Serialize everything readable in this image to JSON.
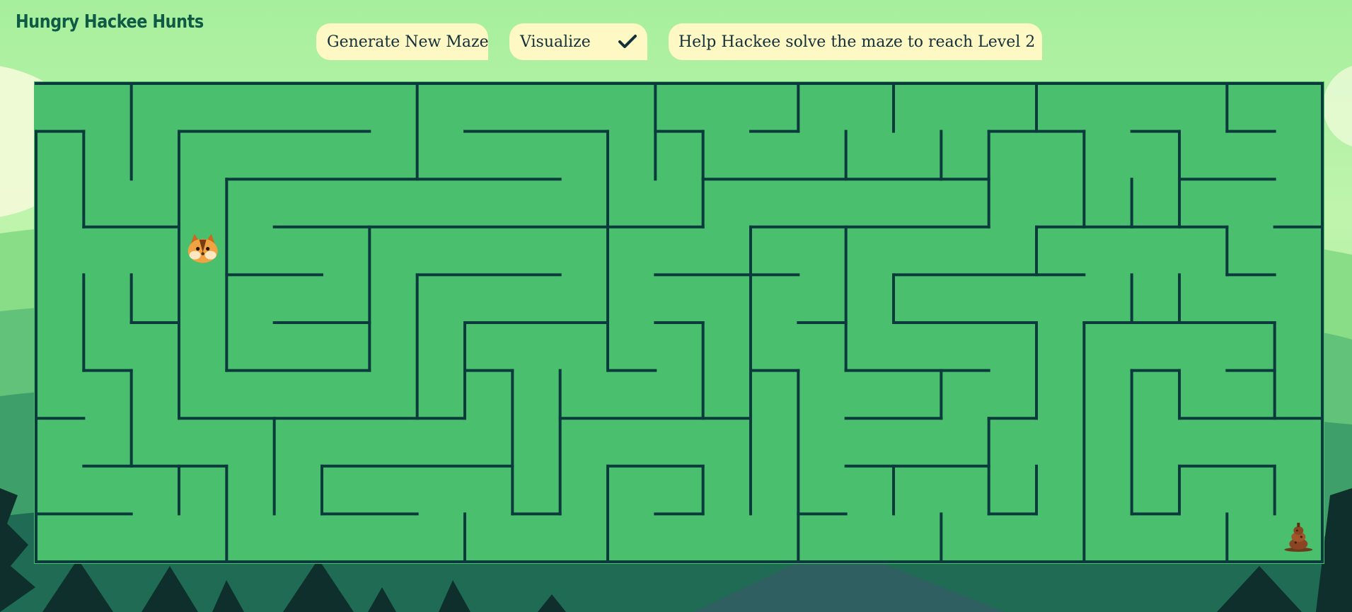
{
  "app": {
    "title": "Hungry Hackee Hunts"
  },
  "toolbar": {
    "generate_label": "Generate New Maze",
    "visualize_label": "Visualize",
    "hint_text": "Help Hackee solve the maze to reach Level 2"
  },
  "icons": {
    "visualize": "checkmark-icon",
    "hint": "lightbulb-icon",
    "player": "chipmunk-icon",
    "goal": "acorn-stack-icon"
  },
  "colors": {
    "maze_floor": "#4ac06e",
    "maze_wall": "#0b3a3c",
    "pill_bg": "#fdf8c4",
    "logo": "#0f5a45",
    "bulb": "#f2a51c"
  },
  "maze": {
    "cols": 27,
    "rows": 10,
    "player": {
      "col": 3,
      "row": 3
    },
    "goal": {
      "col": 26,
      "row": 9
    },
    "walls": {
      "h": [
        "0-1:1",
        "3-7:1",
        "9-12:1",
        "13-14:1",
        "15-16:1",
        "20-22:1",
        "23-24:1",
        "25-26:1",
        "4-11:2",
        "14-19:2",
        "19-20:2",
        "24-26:2",
        "1-3:3",
        "5-14:3",
        "15-20:3",
        "21-25:3",
        "26-27:3",
        "4-6:4",
        "8-11:4",
        "13-16:4",
        "18-22:4",
        "25-26:4",
        "2-3:5",
        "5-7:5",
        "9-12:5",
        "13-14:5",
        "16-17:5",
        "18-21:5",
        "22-24:5",
        "24-26:5",
        "1-2:6",
        "4-7:6",
        "9-10:6",
        "12-13:6",
        "15-16:6",
        "17-20:6",
        "23-24:6",
        "25-26:6",
        "0-1:7",
        "3-9:7",
        "11-15:7",
        "17-19:7",
        "20-21:7",
        "24-27:7",
        "1-4:8",
        "6-10:8",
        "12-14:8",
        "17-20:8",
        "24-26:8",
        "0-2:9",
        "6-8:9",
        "10-11:9",
        "13-14:9",
        "16-17:9",
        "20-21:9",
        "23-24:9"
      ],
      "v": [
        "0:1-10",
        "27:0-10",
        "2:0-2",
        "8:0-2",
        "13:0-2",
        "16:0-1",
        "18:0-1",
        "21:0-1",
        "25:0-1",
        "1:1-3",
        "3:1-7",
        "12:1-6",
        "14:1-3",
        "17:1-2",
        "19:1-2",
        "20:1-3",
        "22:1-3",
        "24:1-3",
        "4:2-6",
        "23:2-3",
        "7:3-6",
        "15:3-7",
        "17:3-6",
        "21:3-4",
        "25:3-4",
        "1:4-6",
        "2:4-5",
        "8:4-7",
        "18:4-5",
        "23:4-5",
        "24:4-5",
        "9:5-7",
        "14:5-7",
        "21:5-7",
        "22:5-10",
        "26:5-7",
        "2:6-8",
        "10:6-9",
        "11:6-9",
        "16:6-10",
        "19:6-7",
        "23:6-9",
        "24:6-7",
        "5:7-9",
        "15:7-9",
        "20:7-9",
        "3:8-9",
        "4:8-10",
        "6:8-9",
        "12:8-10",
        "14:8-9",
        "18:8-9",
        "21:8-9",
        "24:8-9",
        "26:8-9",
        "9:9-10",
        "19:9-10",
        "25:9-10"
      ]
    }
  }
}
